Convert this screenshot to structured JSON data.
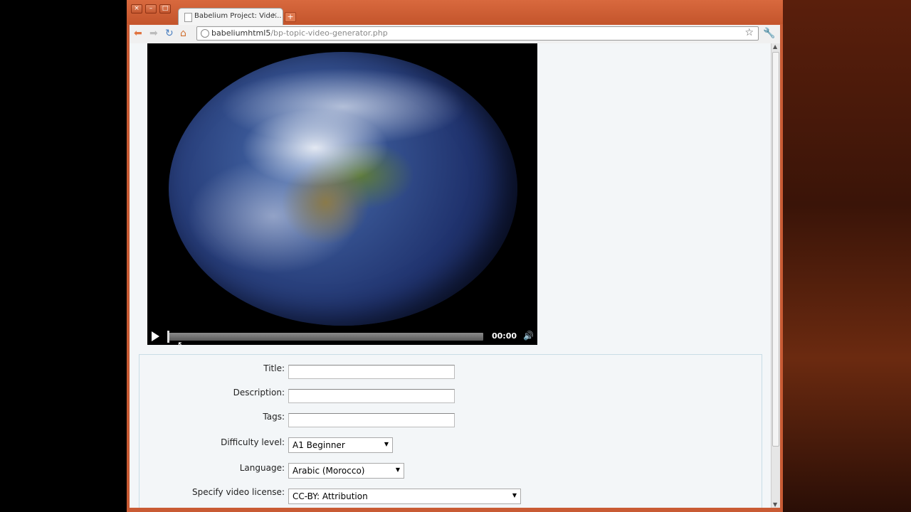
{
  "browser": {
    "tab_title": "Babelium Project: Vide...",
    "tab_close": "×",
    "new_tab": "+",
    "url_host": "babeliumhtml5",
    "url_path": "/bp-topic-video-generator.php",
    "win_close": "×",
    "win_minimize": "–",
    "win_maximize": "□"
  },
  "player": {
    "time": "00:00",
    "progress": 0
  },
  "form": {
    "title_label": "Title:",
    "title_value": "",
    "description_label": "Description:",
    "description_value": "",
    "tags_label": "Tags:",
    "tags_value": "",
    "difficulty_label": "Difficulty level:",
    "difficulty_value": "A1 Beginner",
    "language_label": "Language:",
    "language_value": "Arabic (Morocco)",
    "license_label": "Specify video license:",
    "license_value": "CC-BY: Attribution"
  }
}
